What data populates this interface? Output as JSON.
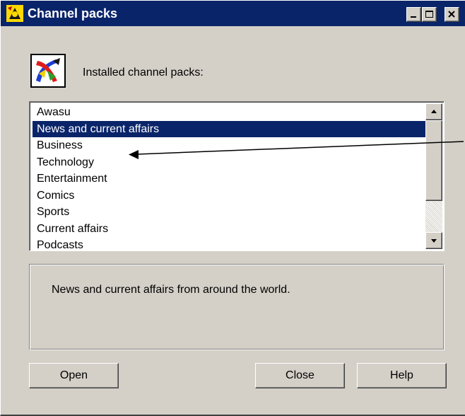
{
  "window": {
    "title": "Channel packs",
    "controls": {
      "minimize_icon": "minimize-icon",
      "maximize_icon": "maximize-icon",
      "close_icon": "close-icon"
    }
  },
  "header": {
    "label": "Installed channel packs:",
    "icon": "channel-pack-logo-icon"
  },
  "channel_list": {
    "items": [
      {
        "label": "Awasu",
        "selected": false
      },
      {
        "label": "News and current affairs",
        "selected": true
      },
      {
        "label": "Business",
        "selected": false
      },
      {
        "label": "Technology",
        "selected": false
      },
      {
        "label": "Entertainment",
        "selected": false
      },
      {
        "label": "Comics",
        "selected": false
      },
      {
        "label": "Sports",
        "selected": false
      },
      {
        "label": "Current affairs",
        "selected": false
      },
      {
        "label": "Podcasts",
        "selected": false
      }
    ]
  },
  "description": {
    "text": "News and current affairs from around the world."
  },
  "buttons": {
    "open": "Open",
    "close": "Close",
    "help": "Help"
  },
  "colors": {
    "titlebar": "#0a246a",
    "face": "#d4d0c8",
    "selection": "#0a246a"
  }
}
